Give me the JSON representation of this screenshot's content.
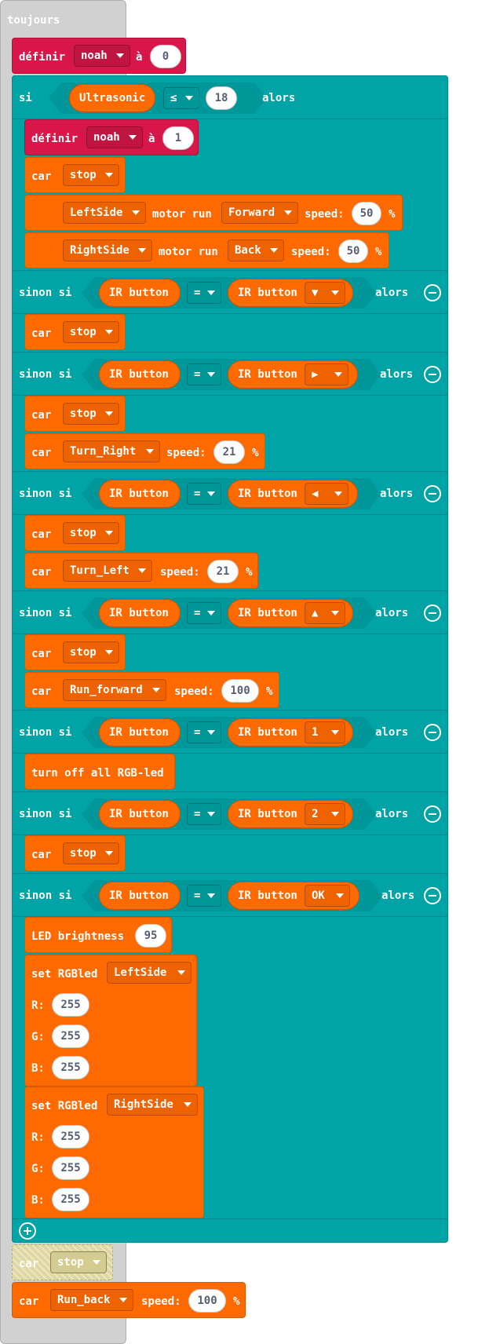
{
  "forever_label": "toujours",
  "set_var": {
    "verb": "définir",
    "var": "noah",
    "to": "à",
    "value0": "0",
    "value1": "1"
  },
  "if_block": {
    "si": "si",
    "sinon_si": "sinon si",
    "alors": "alors",
    "sensor": "Ultrasonic",
    "op_le": "≤",
    "threshold": "18"
  },
  "car": {
    "label": "car",
    "stop": "stop",
    "motor_run": "motor run",
    "speed": "speed:",
    "percent": "%",
    "left_side": "LeftSide",
    "right_side": "RightSide",
    "forward": "Forward",
    "back": "Back",
    "speed50": "50",
    "turn_right": "Turn_Right",
    "turn_left": "Turn_Left",
    "speed21": "21",
    "run_forward": "Run_forward",
    "speed100": "100",
    "run_back": "Run_back"
  },
  "ir": {
    "button": "IR button",
    "eq": "=",
    "down": "▼",
    "right": "▶",
    "left": "◀",
    "up": "▲",
    "one": "1",
    "two": "2",
    "ok": "OK"
  },
  "led": {
    "off_all": "turn off all RGB-led",
    "brightness": "LED brightness",
    "brightness_value": "95",
    "set": "set RGBled",
    "r": "R:",
    "g": "G:",
    "b": "B:",
    "value": "255"
  }
}
